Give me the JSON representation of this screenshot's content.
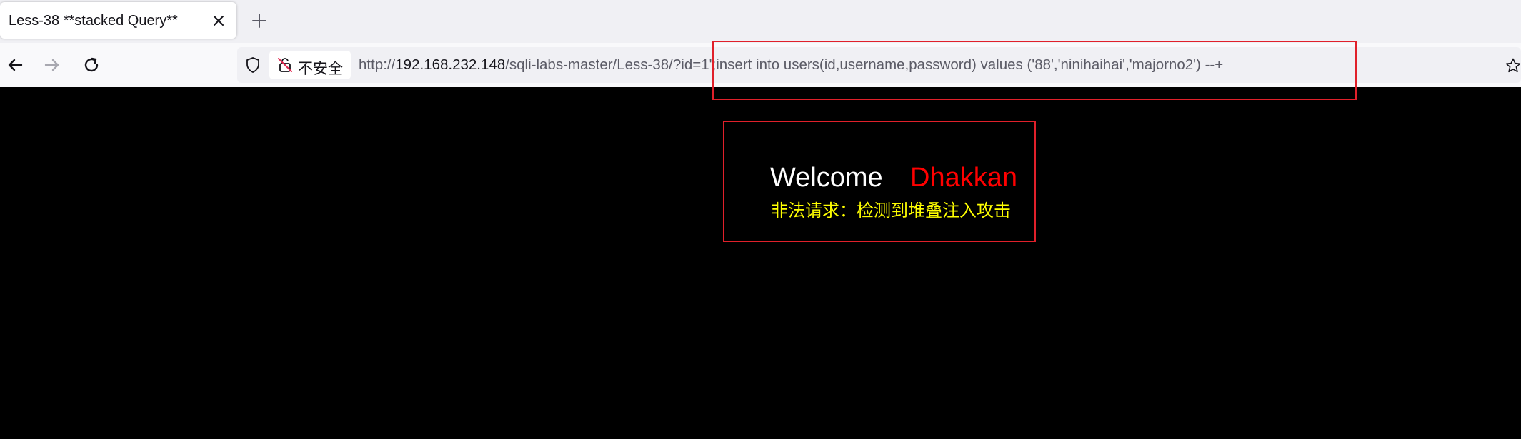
{
  "browser": {
    "tab": {
      "title": "Less-38 **stacked Query**",
      "close_icon": "close-icon"
    },
    "new_tab_icon": "plus-icon",
    "nav": {
      "back_icon": "arrow-left-icon",
      "forward_icon": "arrow-right-icon",
      "reload_icon": "reload-icon"
    },
    "urlbar": {
      "shield_icon": "shield-icon",
      "security_label": "不安全",
      "security_icon": "insecure-lock-icon",
      "url_prefix": "http://",
      "url_host": "192.168.232.148",
      "url_path": "/sqli-labs-master/Less-38/?id=1';insert into users(id,username,password) values ('88','ninihaihai','majorno2') --+",
      "bookmark_icon": "star-icon"
    }
  },
  "page": {
    "welcome": "Welcome",
    "name": "Dhakkan",
    "message": "非法请求：检测到堆叠注入攻击"
  },
  "colors": {
    "page_background": "#000000",
    "welcome": "#ffffff",
    "name": "#ff0000",
    "message": "#ffff00",
    "highlight_border": "#e0202a"
  }
}
